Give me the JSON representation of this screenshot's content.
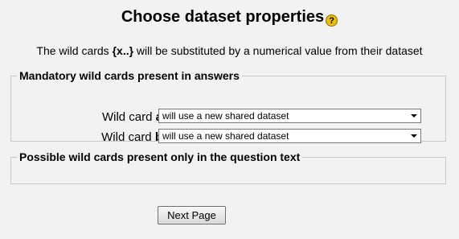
{
  "title": "Choose dataset properties",
  "help_icon": {
    "name": "help-icon",
    "glyph": "?"
  },
  "intro": {
    "before": "The wild cards ",
    "highlight": "{x..}",
    "after": " will be substituted by a numerical value from their dataset"
  },
  "mandatory": {
    "legend": "Mandatory wild cards present in answers",
    "rows": [
      {
        "label": "Wild card ",
        "var": "a",
        "selected": "will use a new shared dataset"
      },
      {
        "label": "Wild card ",
        "var": "b",
        "selected": "will use a new shared dataset"
      }
    ]
  },
  "possible": {
    "legend": "Possible wild cards present only in the question text"
  },
  "next_button": "Next Page",
  "colors": {
    "background": "#f2f2f2",
    "border": "#c8c8c8",
    "help_icon": "#e8c000"
  }
}
